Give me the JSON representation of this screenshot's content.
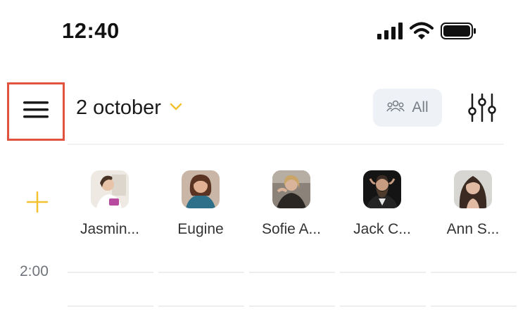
{
  "status_bar": {
    "time": "12:40",
    "icons": [
      "cellular-signal-icon",
      "wifi-icon",
      "battery-icon"
    ]
  },
  "header": {
    "menu_icon": "hamburger-menu-icon",
    "date": "2 october",
    "filter": {
      "label": "All",
      "icon": "people-group-icon"
    },
    "settings_icon": "sliders-icon"
  },
  "staff": [
    {
      "name": "Jasmin...",
      "avatar": "avatar-jasmin"
    },
    {
      "name": "Eugine",
      "avatar": "avatar-eugine"
    },
    {
      "name": "Sofie A...",
      "avatar": "avatar-sofie"
    },
    {
      "name": "Jack C...",
      "avatar": "avatar-jack"
    },
    {
      "name": "Ann S...",
      "avatar": "avatar-ann"
    }
  ],
  "schedule": {
    "time_slots": [
      "2:00"
    ]
  },
  "colors": {
    "accent": "#f2c230",
    "highlight_border": "#e0533f",
    "chip_bg": "#eef1f5"
  }
}
